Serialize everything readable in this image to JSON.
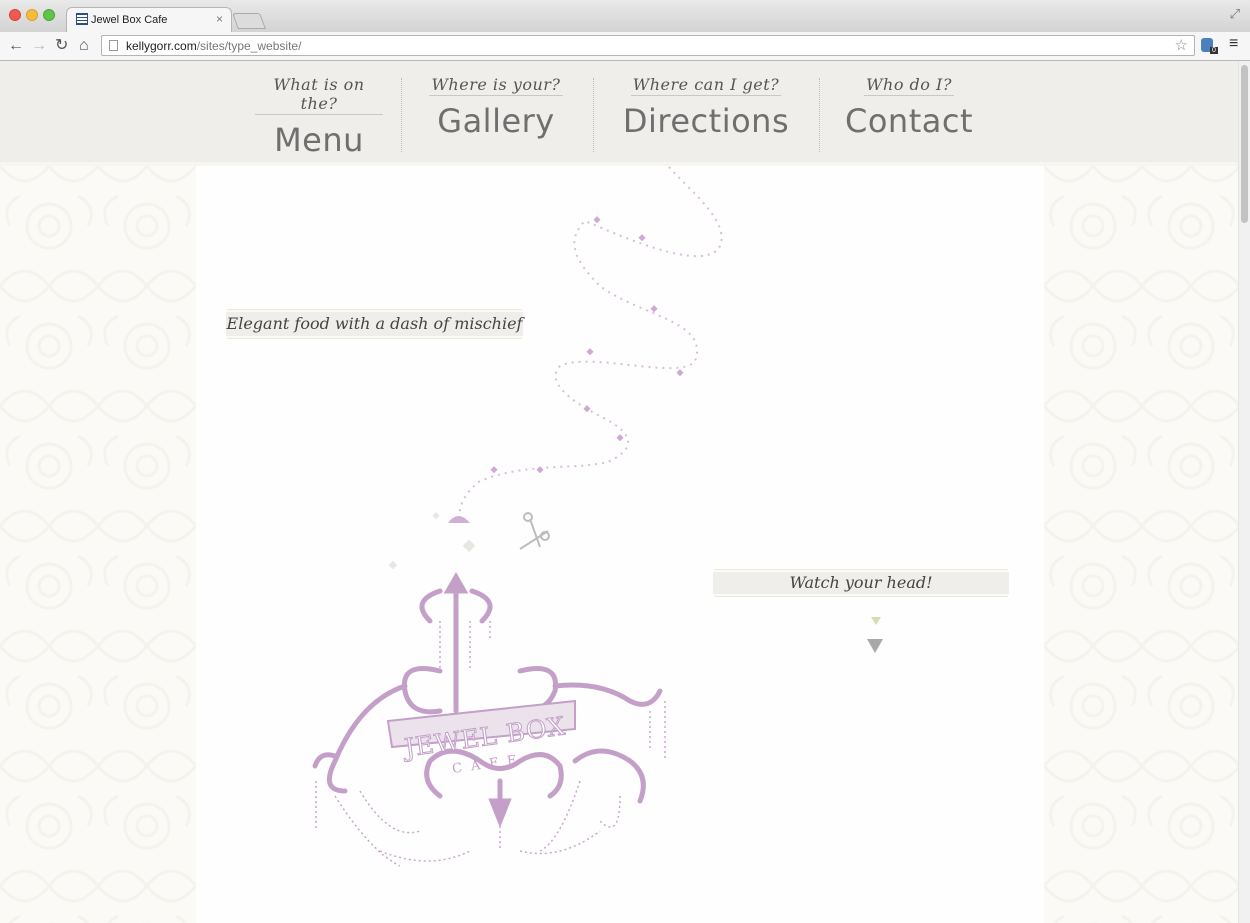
{
  "browser": {
    "tab_title": "Jewel Box Cafe",
    "tab_close": "×",
    "url_domain": "kellygorr.com",
    "url_path": "/sites/type_website/",
    "extension_badge": "0"
  },
  "nav": {
    "items": [
      {
        "small": "What is on the?",
        "big": "Menu"
      },
      {
        "small": "Where is your?",
        "big": "Gallery"
      },
      {
        "small": "Where can I get?",
        "big": "Directions"
      },
      {
        "small": "Who do I?",
        "big": "Contact"
      }
    ]
  },
  "content": {
    "tagline": "Elegant food with a dash of mischief",
    "watch_label": "Watch your head!"
  },
  "logo": {
    "text_main": "JEWEL BOX",
    "text_sub": "CAFE"
  },
  "colors": {
    "accent_lilac": "#c4a0c9",
    "nav_bg": "#efeeea",
    "page_bg": "#fbfaf6"
  }
}
